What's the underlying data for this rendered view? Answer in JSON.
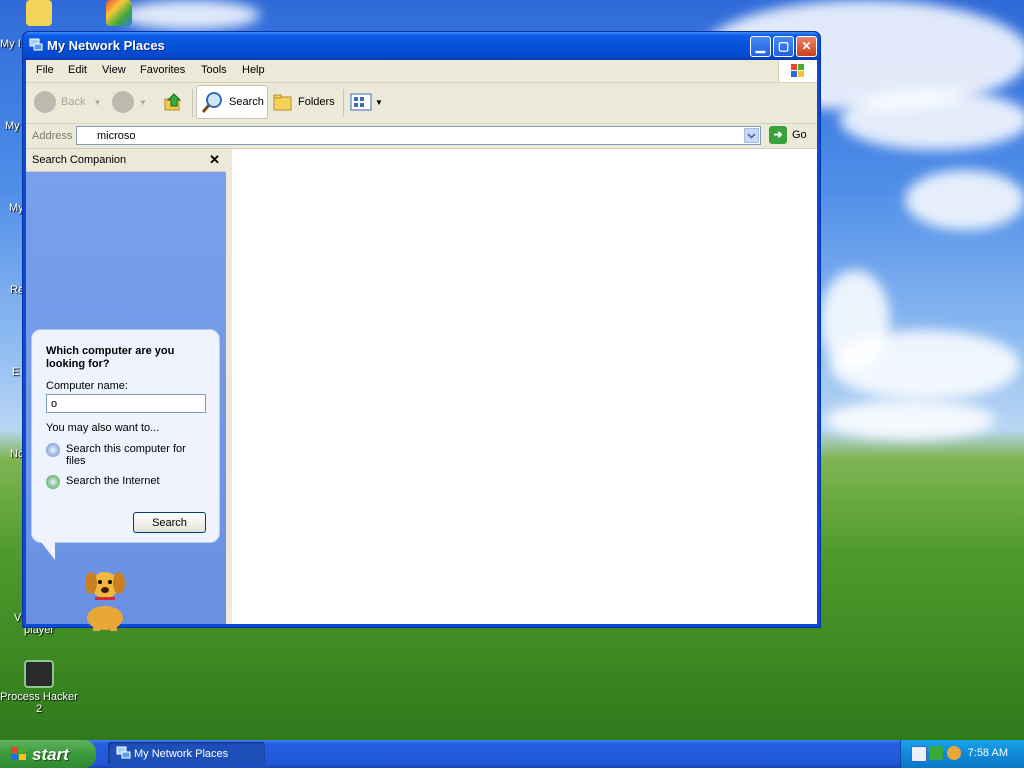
{
  "window": {
    "title": "My Network Places",
    "menu": [
      "File",
      "Edit",
      "View",
      "Favorites",
      "Tools",
      "Help"
    ],
    "toolbar": {
      "back_label": "Back",
      "search_label": "Search",
      "folders_label": "Folders"
    },
    "address": {
      "label": "Address",
      "value": "microso",
      "go_label": "Go"
    }
  },
  "search_companion": {
    "title": "Search Companion",
    "question": "Which computer are you looking for?",
    "computer_name_label": "Computer name:",
    "computer_name_value": "o",
    "also_label": "You may also want to...",
    "options": [
      "Search this computer for files",
      "Search the Internet"
    ],
    "search_button": "Search"
  },
  "desktop": {
    "clipped_labels": [
      "My I",
      "My",
      "My",
      "Re",
      "E",
      "Nc",
      "Vl"
    ],
    "icons": {
      "player_label": "player",
      "process_hacker_label": "Process Hacker 2"
    }
  },
  "taskbar": {
    "start_label": "start",
    "task_label": "My Network Places",
    "clock": "7:58 AM"
  },
  "colors": {
    "title_blue": "#0552dc",
    "start_green": "#3c9a3c",
    "pane_blue": "#6f94e8"
  }
}
